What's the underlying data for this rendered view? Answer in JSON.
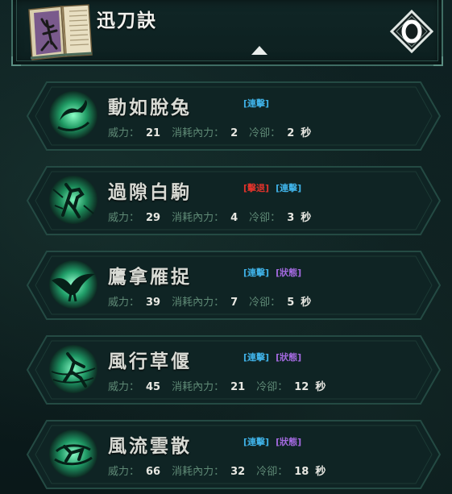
{
  "header": {
    "title": "迅刀訣",
    "book_icon": "martial-arts-manual-icon",
    "collapse_icon": "triangle-up-icon",
    "mode_icon": "ring-diamond-icon"
  },
  "labels": {
    "power": "威力：",
    "cost": "消耗內力：",
    "cooldown": "冷卻：",
    "seconds": "秒"
  },
  "skills": [
    {
      "name": "動如脫兔",
      "icon": "rabbit-icon",
      "tags": [
        {
          "text": "[連擊]",
          "kind": "lianji"
        }
      ],
      "power": "21",
      "cost": "2",
      "cooldown": "2"
    },
    {
      "name": "過隙白駒",
      "icon": "horse-icon",
      "tags": [
        {
          "text": "[擊退]",
          "kind": "jiji"
        },
        {
          "text": "[連擊]",
          "kind": "lianji"
        }
      ],
      "power": "29",
      "cost": "4",
      "cooldown": "3"
    },
    {
      "name": "鷹拿雁捉",
      "icon": "eagle-icon",
      "tags": [
        {
          "text": "[連擊]",
          "kind": "lianji"
        },
        {
          "text": "[狀態]",
          "kind": "zhuangtai"
        }
      ],
      "power": "39",
      "cost": "7",
      "cooldown": "5"
    },
    {
      "name": "風行草偃",
      "icon": "wind-warrior-icon",
      "tags": [
        {
          "text": "[連擊]",
          "kind": "lianji"
        },
        {
          "text": "[狀態]",
          "kind": "zhuangtai"
        }
      ],
      "power": "45",
      "cost": "21",
      "cooldown": "12"
    },
    {
      "name": "風流雲散",
      "icon": "cloud-swirl-icon",
      "tags": [
        {
          "text": "[連擊]",
          "kind": "lianji"
        },
        {
          "text": "[狀態]",
          "kind": "zhuangtai"
        }
      ],
      "power": "66",
      "cost": "32",
      "cooldown": "18"
    }
  ],
  "colors": {
    "accent_green": "#3ed49a",
    "tag_combo": "#3fb1e6",
    "tag_knockback": "#e0332b",
    "tag_status": "#a46ae0"
  }
}
